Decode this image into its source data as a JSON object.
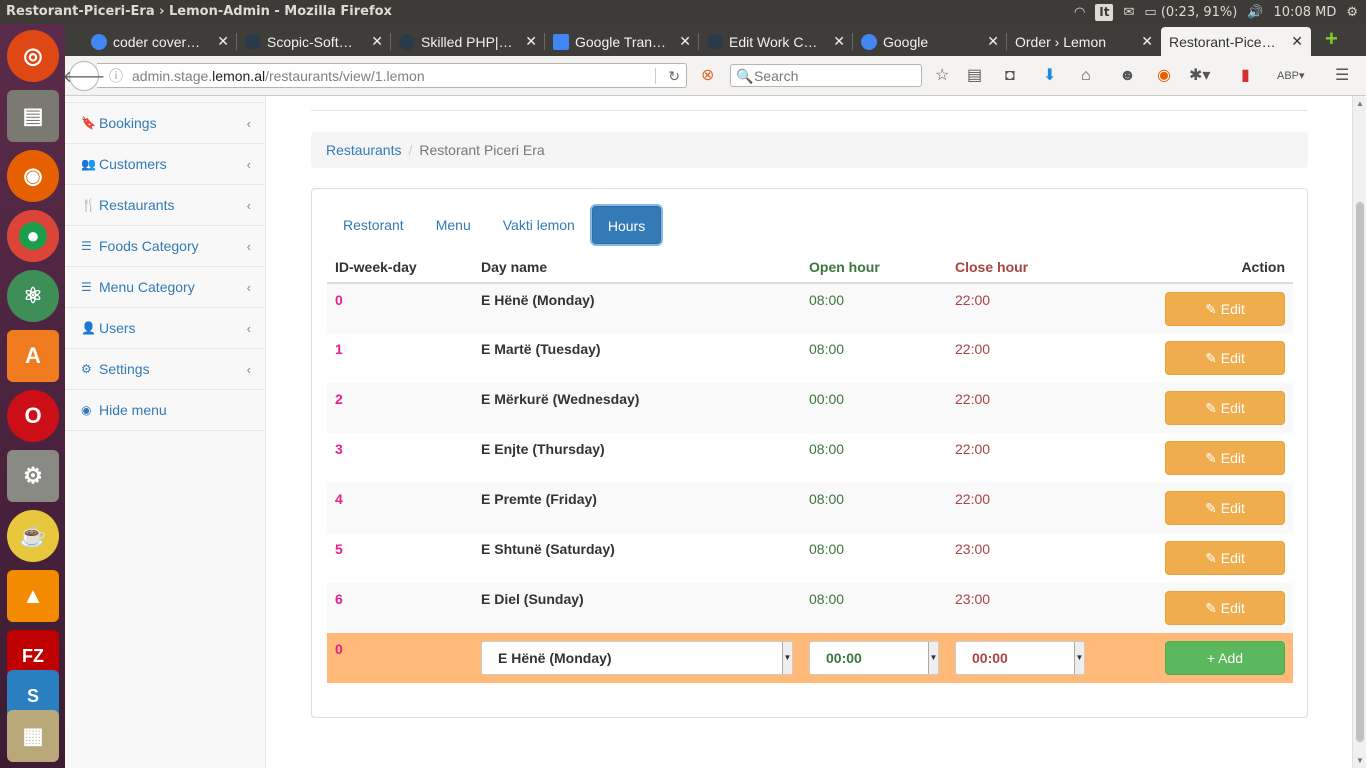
{
  "os": {
    "window_title": "Restorant-Piceri-Era › Lemon-Admin - Mozilla Firefox",
    "lang": "It",
    "battery": "(0:23, 91%)",
    "clock": "10:08 MD"
  },
  "tabs": [
    {
      "label": "coder cover…",
      "fav_color": "#4285f4"
    },
    {
      "label": "Scopic-Soft…",
      "fav_color": "#2b3a4a"
    },
    {
      "label": "Skilled PHP|…",
      "fav_color": "#2b3a4a"
    },
    {
      "label": "Google Tran…",
      "fav_color": "#4285f4"
    },
    {
      "label": "Edit Work C…",
      "fav_color": "#2b3a4a"
    },
    {
      "label": "Google",
      "fav_color": "#4285f4"
    },
    {
      "label": "Order › Lemon",
      "fav_color": ""
    },
    {
      "label": "Restorant-Pice…",
      "fav_color": ""
    }
  ],
  "nav": {
    "url_prefix": "admin.stage.",
    "url_domain": "lemon.al",
    "url_path": "/restaurants/view/1.lemon",
    "search_placeholder": "Search"
  },
  "sidebar": {
    "items": [
      {
        "label": "Bookings",
        "icon": "bookmark-icon",
        "glyph": "🔖"
      },
      {
        "label": "Customers",
        "icon": "users-icon",
        "glyph": "👥"
      },
      {
        "label": "Restaurants",
        "icon": "cutlery-icon",
        "glyph": "🍴"
      },
      {
        "label": "Foods Category",
        "icon": "list-icon",
        "glyph": "☰"
      },
      {
        "label": "Menu Category",
        "icon": "list-icon",
        "glyph": "☰"
      },
      {
        "label": "Users",
        "icon": "user-icon",
        "glyph": "👤"
      },
      {
        "label": "Settings",
        "icon": "cogs-icon",
        "glyph": "⚙"
      },
      {
        "label": "Hide menu",
        "icon": "eye-slash-icon",
        "glyph": "◉"
      }
    ]
  },
  "breadcrumb": {
    "link": "Restaurants",
    "separator": "/",
    "current": "Restorant Piceri Era"
  },
  "pills": [
    "Restorant",
    "Menu",
    "Vakti lemon",
    "Hours"
  ],
  "table": {
    "headers": {
      "id": "ID-week-day",
      "day": "Day name",
      "open": "Open hour",
      "close": "Close hour",
      "action": "Action"
    },
    "edit_label": "✎ Edit",
    "rows": [
      {
        "id": "0",
        "day": "E Hënë (Monday)",
        "open": "08:00",
        "close": "22:00"
      },
      {
        "id": "1",
        "day": "E Martë (Tuesday)",
        "open": "08:00",
        "close": "22:00"
      },
      {
        "id": "2",
        "day": "E Mërkurë (Wednesday)",
        "open": "00:00",
        "close": "22:00"
      },
      {
        "id": "3",
        "day": "E Enjte (Thursday)",
        "open": "08:00",
        "close": "22:00"
      },
      {
        "id": "4",
        "day": "E Premte (Friday)",
        "open": "08:00",
        "close": "22:00"
      },
      {
        "id": "5",
        "day": "E Shtunë (Saturday)",
        "open": "08:00",
        "close": "23:00"
      },
      {
        "id": "6",
        "day": "E Diel (Sunday)",
        "open": "08:00",
        "close": "23:00"
      }
    ],
    "add_row": {
      "id": "0",
      "day_select": "E Hënë (Monday)",
      "open_select": "00:00",
      "close_select": "00:00",
      "add_label": "+ Add"
    }
  }
}
